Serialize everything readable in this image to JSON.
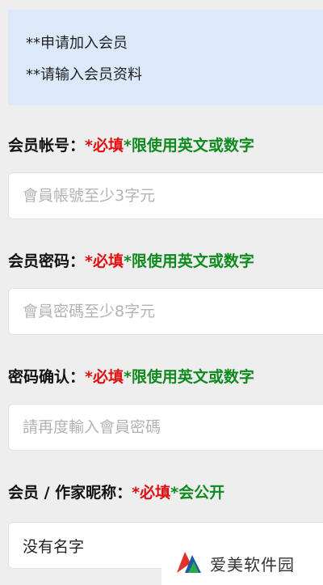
{
  "notice": {
    "line1": "**申请加入会员",
    "line2": "**请输入会员资料"
  },
  "fields": [
    {
      "label": "会员帐号：",
      "required_mark": "*",
      "required_text": "必填",
      "hint_mark": "*",
      "hint_text": "限使用英文或数字",
      "placeholder": "會員帳號至少3字元",
      "value": ""
    },
    {
      "label": "会员密码：",
      "required_mark": "*",
      "required_text": "必填",
      "hint_mark": "*",
      "hint_text": "限使用英文或数字",
      "placeholder": "會員密碼至少8字元",
      "value": ""
    },
    {
      "label": "密码确认：",
      "required_mark": "*",
      "required_text": "必填",
      "hint_mark": "*",
      "hint_text": "限使用英文或数字",
      "placeholder": "請再度輸入會員密碼",
      "value": ""
    },
    {
      "label": "会员 / 作家昵称：",
      "required_mark": "*",
      "required_text": "必填",
      "hint_mark": "*",
      "hint_text": "会公开",
      "placeholder": "",
      "value": "没有名字"
    }
  ],
  "watermark": {
    "text": "爱美软件园"
  },
  "colors": {
    "notice_bg": "#dbe9fb",
    "required": "#e01010",
    "hint": "#0f8a1e",
    "page_bg": "#eeeeee"
  }
}
